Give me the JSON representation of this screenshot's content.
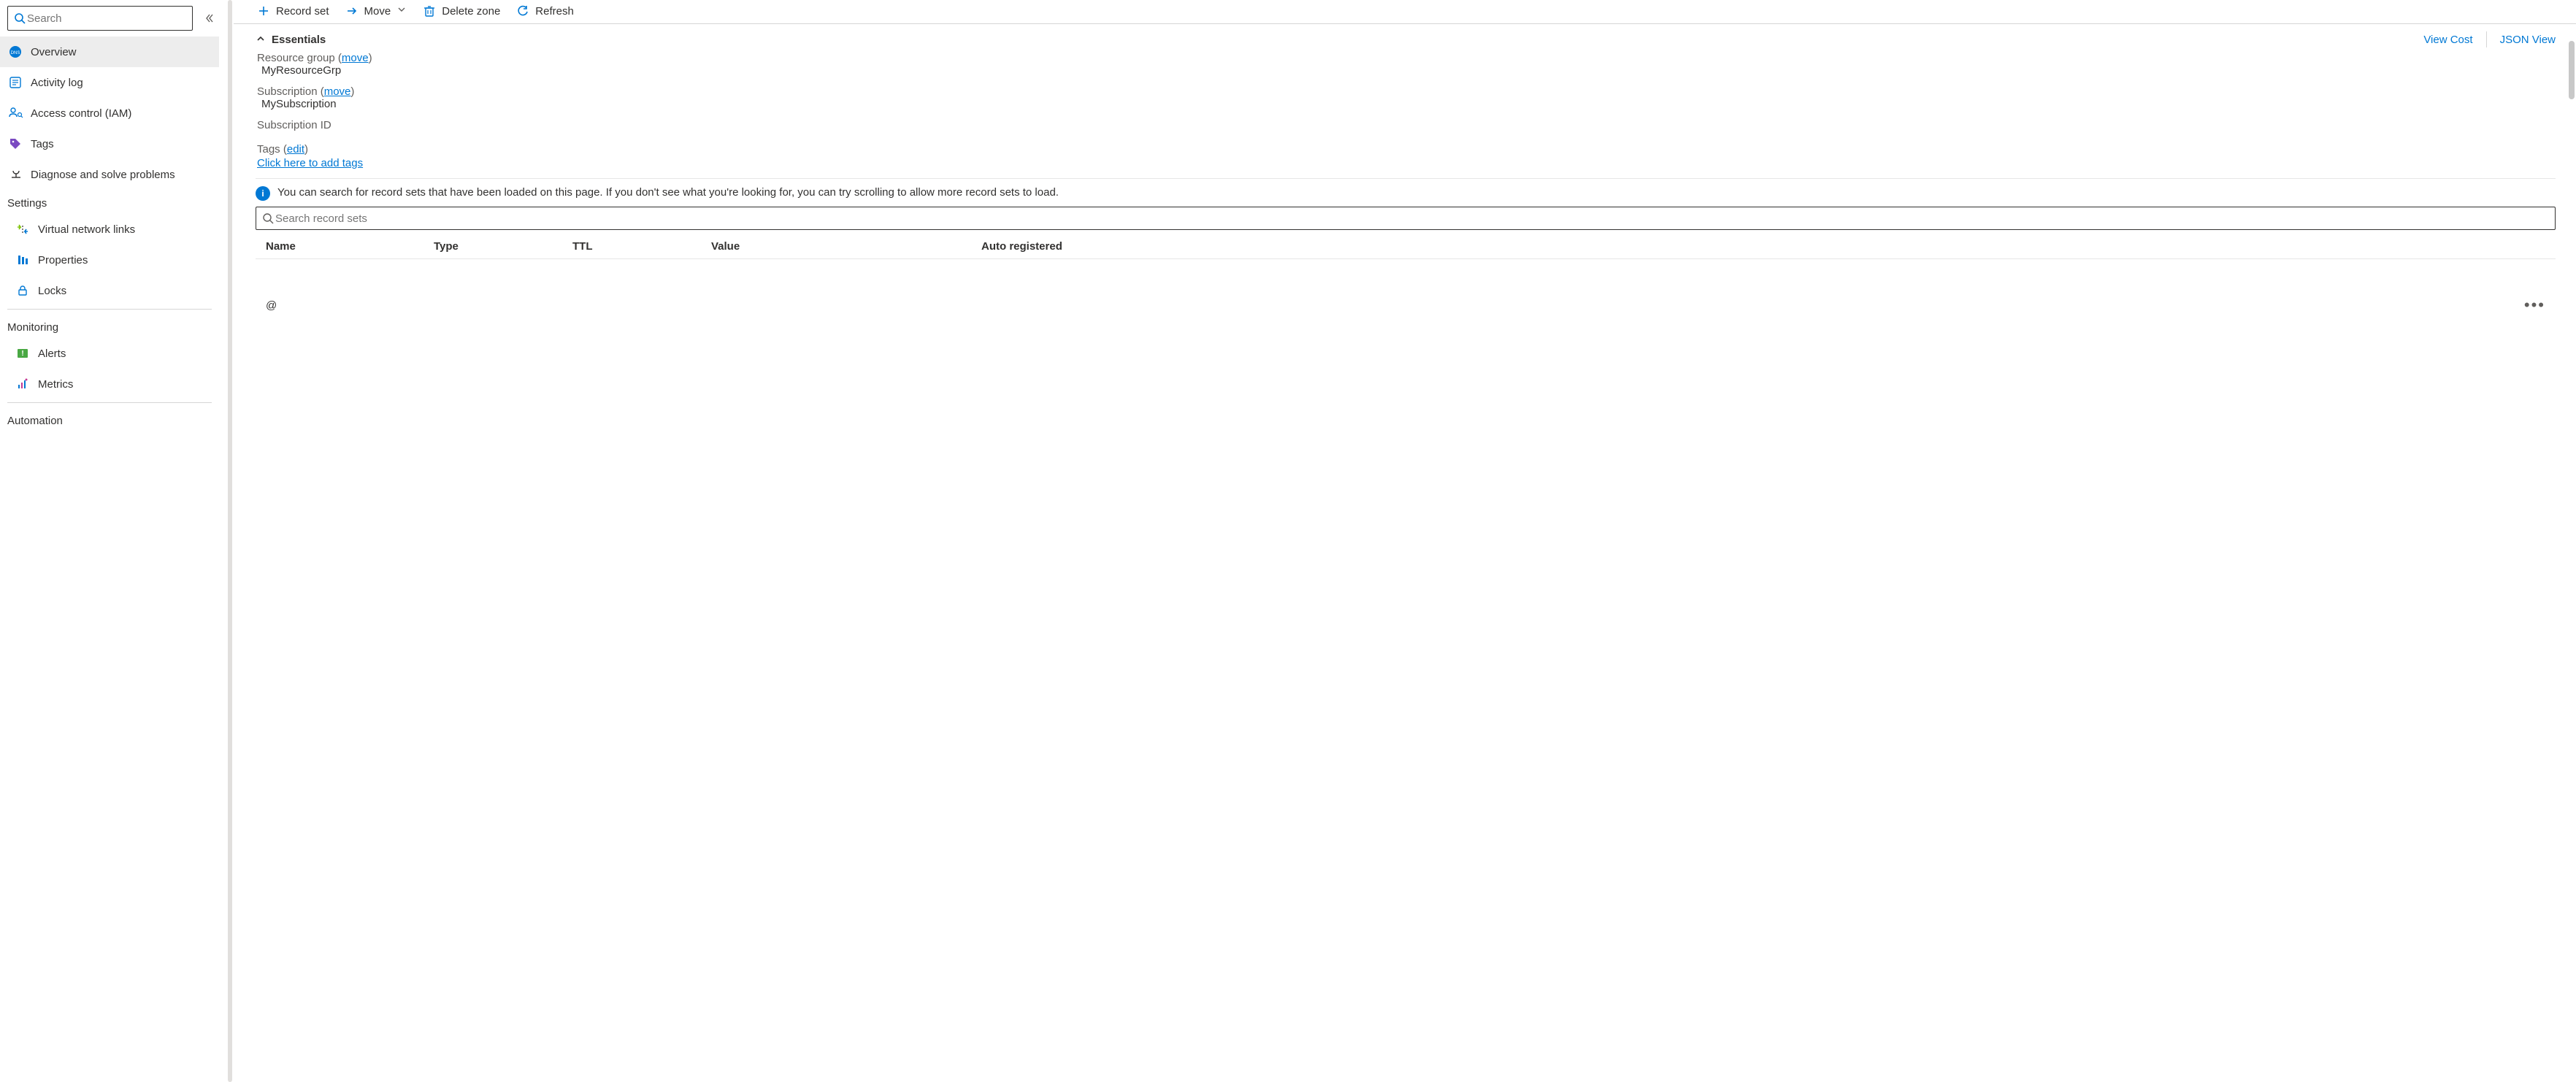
{
  "sidebar": {
    "search_placeholder": "Search",
    "items": [
      {
        "label": "Overview",
        "icon": "dns-icon",
        "selected": true
      },
      {
        "label": "Activity log",
        "icon": "activity-log-icon"
      },
      {
        "label": "Access control (IAM)",
        "icon": "iam-icon"
      },
      {
        "label": "Tags",
        "icon": "tag-icon"
      },
      {
        "label": "Diagnose and solve problems",
        "icon": "diagnose-icon"
      }
    ],
    "groups": [
      {
        "heading": "Settings",
        "items": [
          {
            "label": "Virtual network links",
            "icon": "vnet-icon"
          },
          {
            "label": "Properties",
            "icon": "properties-icon"
          },
          {
            "label": "Locks",
            "icon": "lock-icon"
          }
        ]
      },
      {
        "heading": "Monitoring",
        "items": [
          {
            "label": "Alerts",
            "icon": "alerts-icon"
          },
          {
            "label": "Metrics",
            "icon": "metrics-icon"
          }
        ]
      },
      {
        "heading": "Automation",
        "items": []
      }
    ]
  },
  "toolbar": {
    "record_set": "Record set",
    "move": "Move",
    "delete_zone": "Delete zone",
    "refresh": "Refresh"
  },
  "essentials": {
    "title": "Essentials",
    "view_cost": "View Cost",
    "json_view": "JSON View",
    "resource_group_label": "Resource group",
    "resource_group_move": "move",
    "resource_group_value": "MyResourceGrp",
    "subscription_label": "Subscription",
    "subscription_move": "move",
    "subscription_value": "MySubscription",
    "subscription_id_label": "Subscription ID",
    "tags_label": "Tags",
    "tags_edit": "edit",
    "tags_add": "Click here to add tags"
  },
  "info": {
    "message": "You can search for record sets that have been loaded on this page. If you don't see what you're looking for, you can try scrolling to allow more record sets to load."
  },
  "records": {
    "search_placeholder": "Search record sets",
    "headers": {
      "name": "Name",
      "type": "Type",
      "ttl": "TTL",
      "value": "Value",
      "auto": "Auto registered"
    },
    "rows": [
      {
        "name": "@",
        "type": "",
        "ttl": "",
        "value": "",
        "auto": ""
      }
    ]
  }
}
